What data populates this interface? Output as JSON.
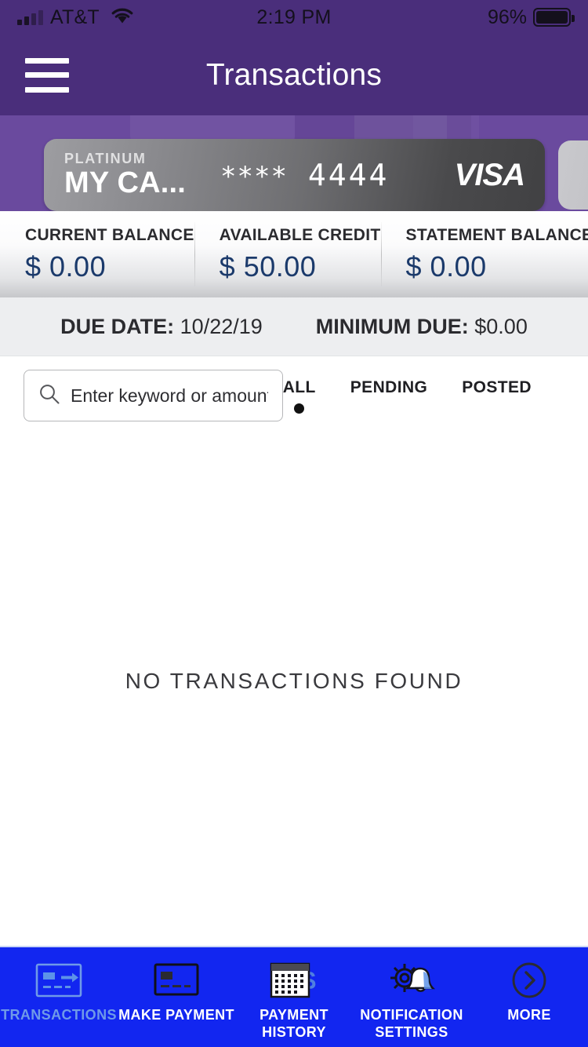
{
  "status_bar": {
    "carrier": "AT&T",
    "time": "2:19 PM",
    "battery_percent": "96%",
    "signal_icon": "signal-bars-icon",
    "wifi_icon": "wifi-icon",
    "battery_icon": "battery-icon"
  },
  "header": {
    "title": "Transactions",
    "menu_icon": "hamburger-menu-icon",
    "background_color": "#4a2e7b"
  },
  "card": {
    "tier": "PLATINUM",
    "nickname": "MY CA...",
    "masked_prefix": "****",
    "last_four": "4444",
    "network": "VISA",
    "carousel_band_color": "#6a4a9e"
  },
  "balances": [
    {
      "label": "CURRENT BALANCE",
      "value": "$ 0.00"
    },
    {
      "label": "AVAILABLE CREDIT",
      "value": "$ 50.00"
    },
    {
      "label": "STATEMENT BALANCE",
      "value": "$ 0.00"
    }
  ],
  "due": {
    "due_date_label": "DUE DATE:",
    "due_date_value": "10/22/19",
    "minimum_due_label": "MINIMUM DUE:",
    "minimum_due_value": "$0.00"
  },
  "search": {
    "placeholder": "Enter keyword or amount",
    "value": "",
    "icon": "search-icon"
  },
  "filters": [
    {
      "label": "ALL",
      "selected": true
    },
    {
      "label": "PENDING",
      "selected": false
    },
    {
      "label": "POSTED",
      "selected": false
    }
  ],
  "empty_state": {
    "message": "NO TRANSACTIONS FOUND"
  },
  "bottom_nav": {
    "background_color": "#1226f0",
    "active_label_color": "#6f9ae8",
    "items": [
      {
        "label": "TRANSACTIONS",
        "icon": "card-arrow-icon",
        "active": true
      },
      {
        "label": "MAKE PAYMENT",
        "icon": "credit-card-icon",
        "active": false
      },
      {
        "label": "PAYMENT HISTORY",
        "icon": "calendar-dollar-icon",
        "active": false
      },
      {
        "label": "NOTIFICATION SETTINGS",
        "icon": "gear-bell-icon",
        "active": false
      },
      {
        "label": "MORE",
        "icon": "chevron-right-circle-icon",
        "active": false
      }
    ]
  }
}
